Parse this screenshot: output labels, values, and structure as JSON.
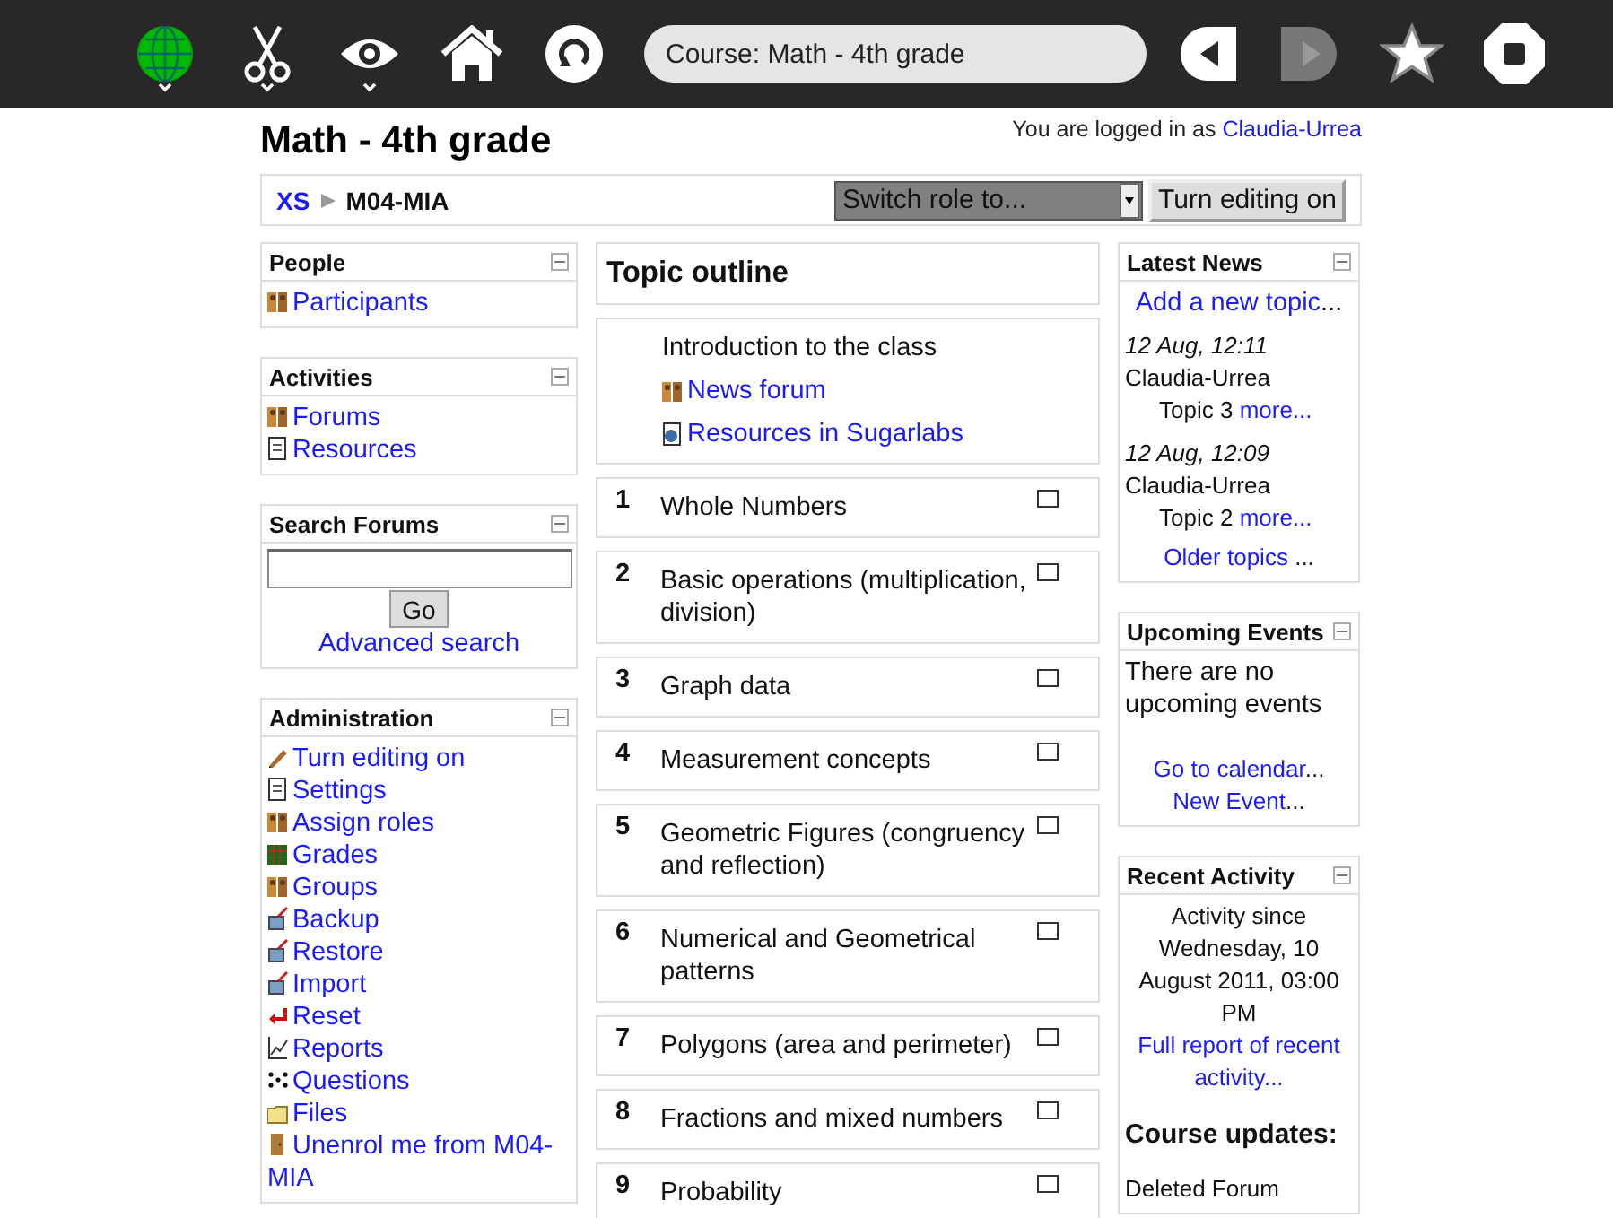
{
  "toolbar": {
    "address": "Course: Math - 4th grade",
    "nav": [
      {
        "kind": "back",
        "disabled": false
      },
      {
        "kind": "forward",
        "disabled": true
      }
    ]
  },
  "header": {
    "title": "Math - 4th grade",
    "login_text": "You are logged in as",
    "user": "Claudia-Urrea"
  },
  "navbar": {
    "breadcrumb": [
      {
        "label": "XS",
        "kind": "link"
      },
      {
        "label": "M04-MIA",
        "kind": "current"
      }
    ],
    "role_select": "Switch role to...",
    "edit_button": "Turn editing on"
  },
  "left_blocks": [
    {
      "title": "People",
      "kind": "links",
      "items": [
        {
          "kind": "people",
          "label": "Participants"
        }
      ]
    },
    {
      "title": "Activities",
      "kind": "links",
      "items": [
        {
          "kind": "people",
          "label": "Forums"
        },
        {
          "kind": "document",
          "label": "Resources"
        }
      ]
    },
    {
      "title": "Search Forums",
      "kind": "search",
      "button": "Go",
      "link": "Advanced search"
    },
    {
      "title": "Administration",
      "kind": "links",
      "items": [
        {
          "kind": "pencil",
          "label": "Turn editing on"
        },
        {
          "kind": "document",
          "label": "Settings"
        },
        {
          "kind": "people",
          "label": "Assign roles"
        },
        {
          "kind": "grid",
          "label": "Grades"
        },
        {
          "kind": "people",
          "label": "Groups"
        },
        {
          "kind": "box",
          "label": "Backup"
        },
        {
          "kind": "box",
          "label": "Restore"
        },
        {
          "kind": "box",
          "label": "Import"
        },
        {
          "kind": "arrow",
          "label": "Reset"
        },
        {
          "kind": "chart",
          "label": "Reports"
        },
        {
          "kind": "dots",
          "label": "Questions"
        },
        {
          "kind": "folder",
          "label": "Files"
        },
        {
          "kind": "door",
          "label": "Unenrol me from M04-MIA"
        }
      ]
    }
  ],
  "outline": {
    "title": "Topic outline",
    "intro": {
      "summary": "Introduction to the class",
      "links": [
        {
          "kind": "people",
          "label": "News forum"
        },
        {
          "kind": "globe",
          "label": "Resources in Sugarlabs"
        }
      ]
    },
    "topics": [
      {
        "number": "1",
        "title": "Whole Numbers"
      },
      {
        "number": "2",
        "title": "Basic operations (multiplication, division)"
      },
      {
        "number": "3",
        "title": "Graph data"
      },
      {
        "number": "4",
        "title": "Measurement concepts"
      },
      {
        "number": "5",
        "title": "Geometric Figures (congruency and reflection)"
      },
      {
        "number": "6",
        "title": "Numerical and Geometrical patterns"
      },
      {
        "number": "7",
        "title": "Polygons (area and perimeter)"
      },
      {
        "number": "8",
        "title": "Fractions and mixed numbers"
      },
      {
        "number": "9",
        "title": "Probability"
      }
    ]
  },
  "latest_news": {
    "title": "Latest News",
    "add_link": "Add a new topic",
    "add_suffix": "...",
    "posts": [
      {
        "date": "12 Aug, 12:11",
        "author": "Claudia-Urrea",
        "topic": "Topic 3",
        "more": "more..."
      },
      {
        "date": "12 Aug, 12:09",
        "author": "Claudia-Urrea",
        "topic": "Topic 2",
        "more": "more..."
      }
    ],
    "older_link": "Older topics",
    "older_suffix": "..."
  },
  "upcoming_events": {
    "title": "Upcoming Events",
    "text": "There are no upcoming events",
    "links": [
      {
        "label": "Go to calendar",
        "suffix": "..."
      },
      {
        "label": "New Event",
        "suffix": "..."
      }
    ]
  },
  "recent_activity": {
    "title": "Recent Activity",
    "since": "Activity since Wednesday, 10 August 2011, 03:00 PM",
    "report_link": "Full report of recent activity...",
    "updates_heading": "Course updates:",
    "updates": [
      "Deleted Forum"
    ]
  }
}
